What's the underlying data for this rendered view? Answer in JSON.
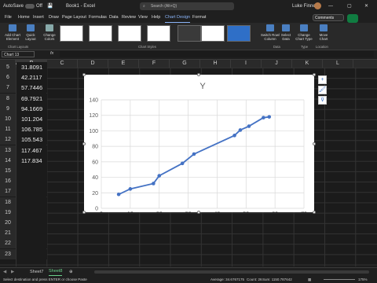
{
  "titlebar": {
    "autosave": "AutoSave",
    "autosave_state": "Off",
    "doc_title": "Book1  -  Excel",
    "search_placeholder": "Search (Alt+Q)",
    "user": "Luke Finney",
    "window_min": "—",
    "window_max": "▢",
    "window_close": "✕"
  },
  "tabs": [
    "File",
    "Home",
    "Insert",
    "Draw",
    "Page Layout",
    "Formulas",
    "Data",
    "Review",
    "View",
    "Help",
    "Chart Design",
    "Format"
  ],
  "active_tab": "Chart Design",
  "comments_label": "Comments",
  "ribbon": {
    "add_chart_element": "Add Chart\nElement",
    "quick_layout": "Quick\nLayout",
    "change_colors": "Change\nColors",
    "switch_row_col": "Switch Row/\nColumn",
    "select_data": "Select\nData",
    "change_chart_type": "Change\nChart Type",
    "move_chart": "Move\nChart",
    "groups": {
      "chart_layouts": "Chart Layouts",
      "chart_styles": "Chart Styles",
      "data": "Data",
      "type": "Type",
      "location": "Location"
    }
  },
  "formula": {
    "name_box": "Chart 13",
    "fx": "fx"
  },
  "columns": [
    "A",
    "B",
    "C",
    "D",
    "E",
    "F",
    "G",
    "H",
    "I",
    "J",
    "K",
    "L"
  ],
  "rows": [
    {
      "num": "5",
      "value": "31.8091"
    },
    {
      "num": "6",
      "value": "42.2117"
    },
    {
      "num": "7",
      "value": "57.7446"
    },
    {
      "num": "8",
      "value": "69.7921"
    },
    {
      "num": "9",
      "value": "94.1669"
    },
    {
      "num": "10",
      "value": "101.204"
    },
    {
      "num": "11",
      "value": "106.785"
    },
    {
      "num": "12",
      "value": "105.543"
    },
    {
      "num": "13",
      "value": "117.467"
    },
    {
      "num": "14",
      "value": "117.834"
    },
    {
      "num": "15",
      "value": ""
    },
    {
      "num": "16",
      "value": ""
    },
    {
      "num": "17",
      "value": ""
    },
    {
      "num": "18",
      "value": ""
    },
    {
      "num": "19",
      "value": ""
    },
    {
      "num": "20",
      "value": ""
    },
    {
      "num": "21",
      "value": ""
    },
    {
      "num": "22",
      "value": ""
    },
    {
      "num": "23",
      "value": ""
    }
  ],
  "chart_data": {
    "type": "line",
    "title": "Y",
    "x": [
      6,
      10,
      18,
      20,
      28,
      32,
      46,
      48,
      51,
      56,
      58
    ],
    "y": [
      18,
      25,
      32,
      42,
      58,
      70,
      94,
      101,
      106,
      117,
      118
    ],
    "xlim": [
      0,
      70
    ],
    "ylim": [
      0,
      140
    ],
    "xticks": [
      0,
      10,
      20,
      30,
      40,
      50,
      60,
      70
    ],
    "yticks": [
      0,
      20,
      40,
      60,
      80,
      100,
      120,
      140
    ],
    "grid": true,
    "color": "#4472c4"
  },
  "chart_side_buttons": {
    "elements": "+",
    "styles": "🖌",
    "filters": "⊽"
  },
  "sheets": [
    "Sheet7",
    "Sheet8"
  ],
  "active_sheet": "Sheet8",
  "status": {
    "message": "Select destination and press ENTER or choose Paste",
    "average": "Average: 34.6767175",
    "count": "Count: 26",
    "sum": "Sum: 1150.787642",
    "zoom": "175%"
  }
}
